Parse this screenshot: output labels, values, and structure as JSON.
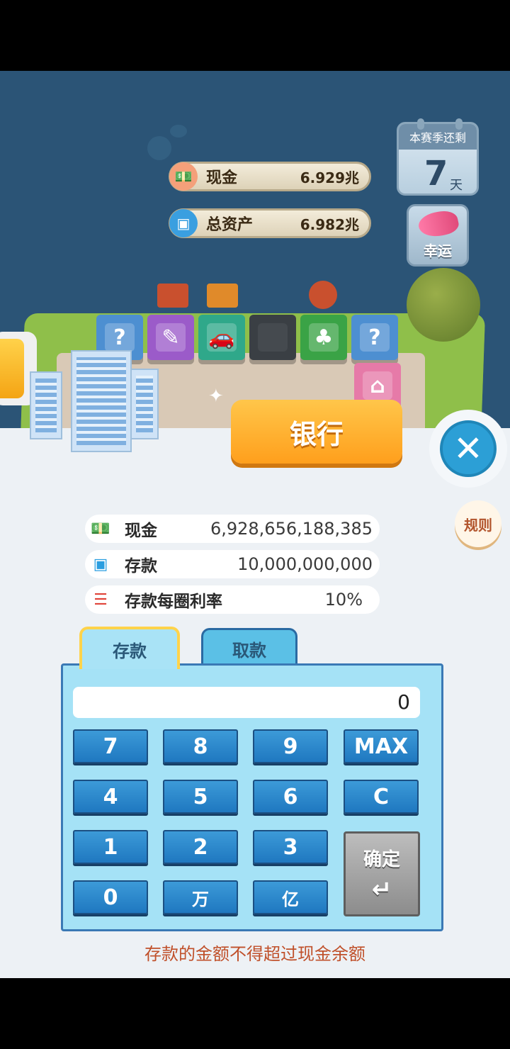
{
  "hud": {
    "cash_label": "现金",
    "cash_value": "6.929兆",
    "assets_label": "总资产",
    "assets_value": "6.982兆",
    "season_label": "本赛季还剩",
    "season_days": "7",
    "season_unit": "天",
    "lucky_label": "幸运"
  },
  "scene": {
    "bank_button_label": "银行"
  },
  "bank": {
    "rules_label": "规则",
    "info": [
      {
        "label": "现金",
        "value": "6,928,656,188,385",
        "icon": "money-icon"
      },
      {
        "label": "存款",
        "value": "10,000,000,000",
        "icon": "wallet-icon"
      },
      {
        "label": "存款每圈利率",
        "value": "10%",
        "icon": "coin-stack-icon"
      }
    ],
    "tabs": [
      {
        "label": "存款",
        "active": true
      },
      {
        "label": "取款",
        "active": false
      }
    ],
    "display_value": "0",
    "keys": [
      "7",
      "8",
      "9",
      "MAX",
      "4",
      "5",
      "6",
      "C",
      "1",
      "2",
      "3",
      "0",
      "万",
      "亿"
    ],
    "confirm_label": "确定",
    "confirm_symbol": "↵",
    "hint": "存款的金额不得超过现金余额"
  },
  "colors": {
    "accent_orange": "#ff9f1c",
    "key_blue": "#1f78c0",
    "panel_bg": "#edf1f5",
    "hint_red": "#c0502a"
  }
}
